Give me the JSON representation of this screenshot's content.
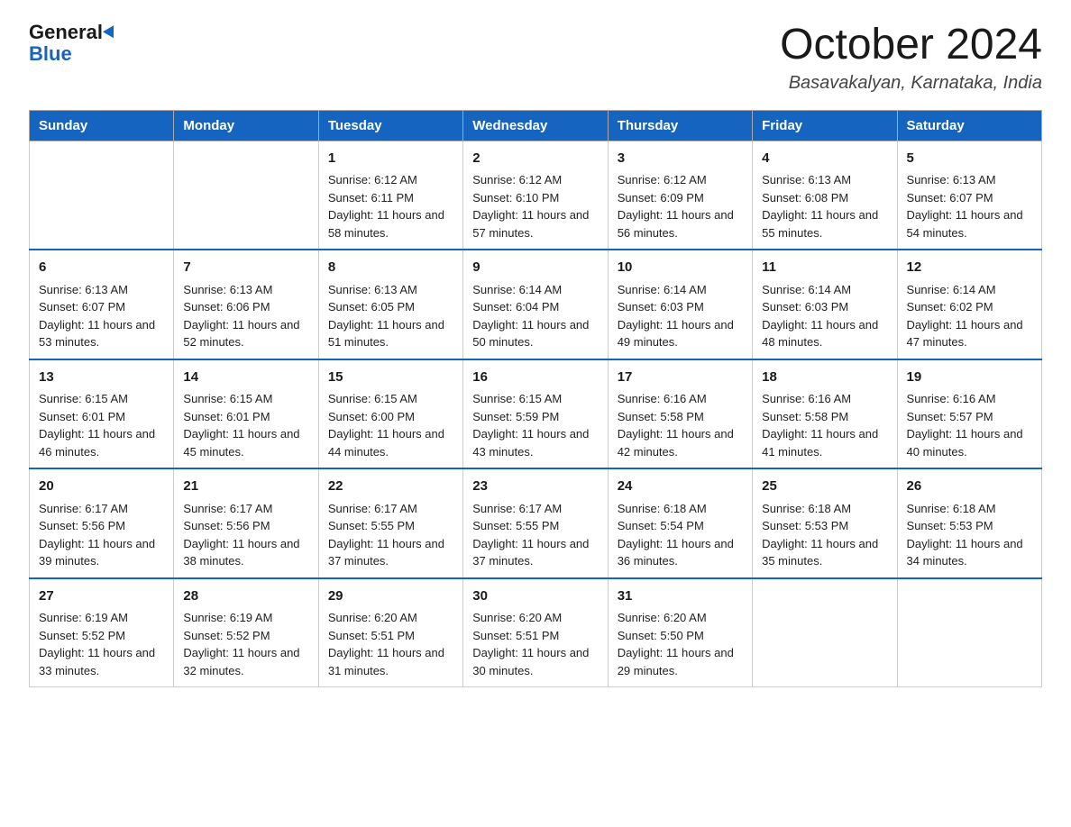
{
  "logo": {
    "general": "General",
    "blue": "Blue"
  },
  "header": {
    "month": "October 2024",
    "location": "Basavakalyan, Karnataka, India"
  },
  "weekdays": [
    "Sunday",
    "Monday",
    "Tuesday",
    "Wednesday",
    "Thursday",
    "Friday",
    "Saturday"
  ],
  "weeks": [
    [
      {
        "day": "",
        "sunrise": "",
        "sunset": "",
        "daylight": ""
      },
      {
        "day": "",
        "sunrise": "",
        "sunset": "",
        "daylight": ""
      },
      {
        "day": "1",
        "sunrise": "Sunrise: 6:12 AM",
        "sunset": "Sunset: 6:11 PM",
        "daylight": "Daylight: 11 hours and 58 minutes."
      },
      {
        "day": "2",
        "sunrise": "Sunrise: 6:12 AM",
        "sunset": "Sunset: 6:10 PM",
        "daylight": "Daylight: 11 hours and 57 minutes."
      },
      {
        "day": "3",
        "sunrise": "Sunrise: 6:12 AM",
        "sunset": "Sunset: 6:09 PM",
        "daylight": "Daylight: 11 hours and 56 minutes."
      },
      {
        "day": "4",
        "sunrise": "Sunrise: 6:13 AM",
        "sunset": "Sunset: 6:08 PM",
        "daylight": "Daylight: 11 hours and 55 minutes."
      },
      {
        "day": "5",
        "sunrise": "Sunrise: 6:13 AM",
        "sunset": "Sunset: 6:07 PM",
        "daylight": "Daylight: 11 hours and 54 minutes."
      }
    ],
    [
      {
        "day": "6",
        "sunrise": "Sunrise: 6:13 AM",
        "sunset": "Sunset: 6:07 PM",
        "daylight": "Daylight: 11 hours and 53 minutes."
      },
      {
        "day": "7",
        "sunrise": "Sunrise: 6:13 AM",
        "sunset": "Sunset: 6:06 PM",
        "daylight": "Daylight: 11 hours and 52 minutes."
      },
      {
        "day": "8",
        "sunrise": "Sunrise: 6:13 AM",
        "sunset": "Sunset: 6:05 PM",
        "daylight": "Daylight: 11 hours and 51 minutes."
      },
      {
        "day": "9",
        "sunrise": "Sunrise: 6:14 AM",
        "sunset": "Sunset: 6:04 PM",
        "daylight": "Daylight: 11 hours and 50 minutes."
      },
      {
        "day": "10",
        "sunrise": "Sunrise: 6:14 AM",
        "sunset": "Sunset: 6:03 PM",
        "daylight": "Daylight: 11 hours and 49 minutes."
      },
      {
        "day": "11",
        "sunrise": "Sunrise: 6:14 AM",
        "sunset": "Sunset: 6:03 PM",
        "daylight": "Daylight: 11 hours and 48 minutes."
      },
      {
        "day": "12",
        "sunrise": "Sunrise: 6:14 AM",
        "sunset": "Sunset: 6:02 PM",
        "daylight": "Daylight: 11 hours and 47 minutes."
      }
    ],
    [
      {
        "day": "13",
        "sunrise": "Sunrise: 6:15 AM",
        "sunset": "Sunset: 6:01 PM",
        "daylight": "Daylight: 11 hours and 46 minutes."
      },
      {
        "day": "14",
        "sunrise": "Sunrise: 6:15 AM",
        "sunset": "Sunset: 6:01 PM",
        "daylight": "Daylight: 11 hours and 45 minutes."
      },
      {
        "day": "15",
        "sunrise": "Sunrise: 6:15 AM",
        "sunset": "Sunset: 6:00 PM",
        "daylight": "Daylight: 11 hours and 44 minutes."
      },
      {
        "day": "16",
        "sunrise": "Sunrise: 6:15 AM",
        "sunset": "Sunset: 5:59 PM",
        "daylight": "Daylight: 11 hours and 43 minutes."
      },
      {
        "day": "17",
        "sunrise": "Sunrise: 6:16 AM",
        "sunset": "Sunset: 5:58 PM",
        "daylight": "Daylight: 11 hours and 42 minutes."
      },
      {
        "day": "18",
        "sunrise": "Sunrise: 6:16 AM",
        "sunset": "Sunset: 5:58 PM",
        "daylight": "Daylight: 11 hours and 41 minutes."
      },
      {
        "day": "19",
        "sunrise": "Sunrise: 6:16 AM",
        "sunset": "Sunset: 5:57 PM",
        "daylight": "Daylight: 11 hours and 40 minutes."
      }
    ],
    [
      {
        "day": "20",
        "sunrise": "Sunrise: 6:17 AM",
        "sunset": "Sunset: 5:56 PM",
        "daylight": "Daylight: 11 hours and 39 minutes."
      },
      {
        "day": "21",
        "sunrise": "Sunrise: 6:17 AM",
        "sunset": "Sunset: 5:56 PM",
        "daylight": "Daylight: 11 hours and 38 minutes."
      },
      {
        "day": "22",
        "sunrise": "Sunrise: 6:17 AM",
        "sunset": "Sunset: 5:55 PM",
        "daylight": "Daylight: 11 hours and 37 minutes."
      },
      {
        "day": "23",
        "sunrise": "Sunrise: 6:17 AM",
        "sunset": "Sunset: 5:55 PM",
        "daylight": "Daylight: 11 hours and 37 minutes."
      },
      {
        "day": "24",
        "sunrise": "Sunrise: 6:18 AM",
        "sunset": "Sunset: 5:54 PM",
        "daylight": "Daylight: 11 hours and 36 minutes."
      },
      {
        "day": "25",
        "sunrise": "Sunrise: 6:18 AM",
        "sunset": "Sunset: 5:53 PM",
        "daylight": "Daylight: 11 hours and 35 minutes."
      },
      {
        "day": "26",
        "sunrise": "Sunrise: 6:18 AM",
        "sunset": "Sunset: 5:53 PM",
        "daylight": "Daylight: 11 hours and 34 minutes."
      }
    ],
    [
      {
        "day": "27",
        "sunrise": "Sunrise: 6:19 AM",
        "sunset": "Sunset: 5:52 PM",
        "daylight": "Daylight: 11 hours and 33 minutes."
      },
      {
        "day": "28",
        "sunrise": "Sunrise: 6:19 AM",
        "sunset": "Sunset: 5:52 PM",
        "daylight": "Daylight: 11 hours and 32 minutes."
      },
      {
        "day": "29",
        "sunrise": "Sunrise: 6:20 AM",
        "sunset": "Sunset: 5:51 PM",
        "daylight": "Daylight: 11 hours and 31 minutes."
      },
      {
        "day": "30",
        "sunrise": "Sunrise: 6:20 AM",
        "sunset": "Sunset: 5:51 PM",
        "daylight": "Daylight: 11 hours and 30 minutes."
      },
      {
        "day": "31",
        "sunrise": "Sunrise: 6:20 AM",
        "sunset": "Sunset: 5:50 PM",
        "daylight": "Daylight: 11 hours and 29 minutes."
      },
      {
        "day": "",
        "sunrise": "",
        "sunset": "",
        "daylight": ""
      },
      {
        "day": "",
        "sunrise": "",
        "sunset": "",
        "daylight": ""
      }
    ]
  ]
}
